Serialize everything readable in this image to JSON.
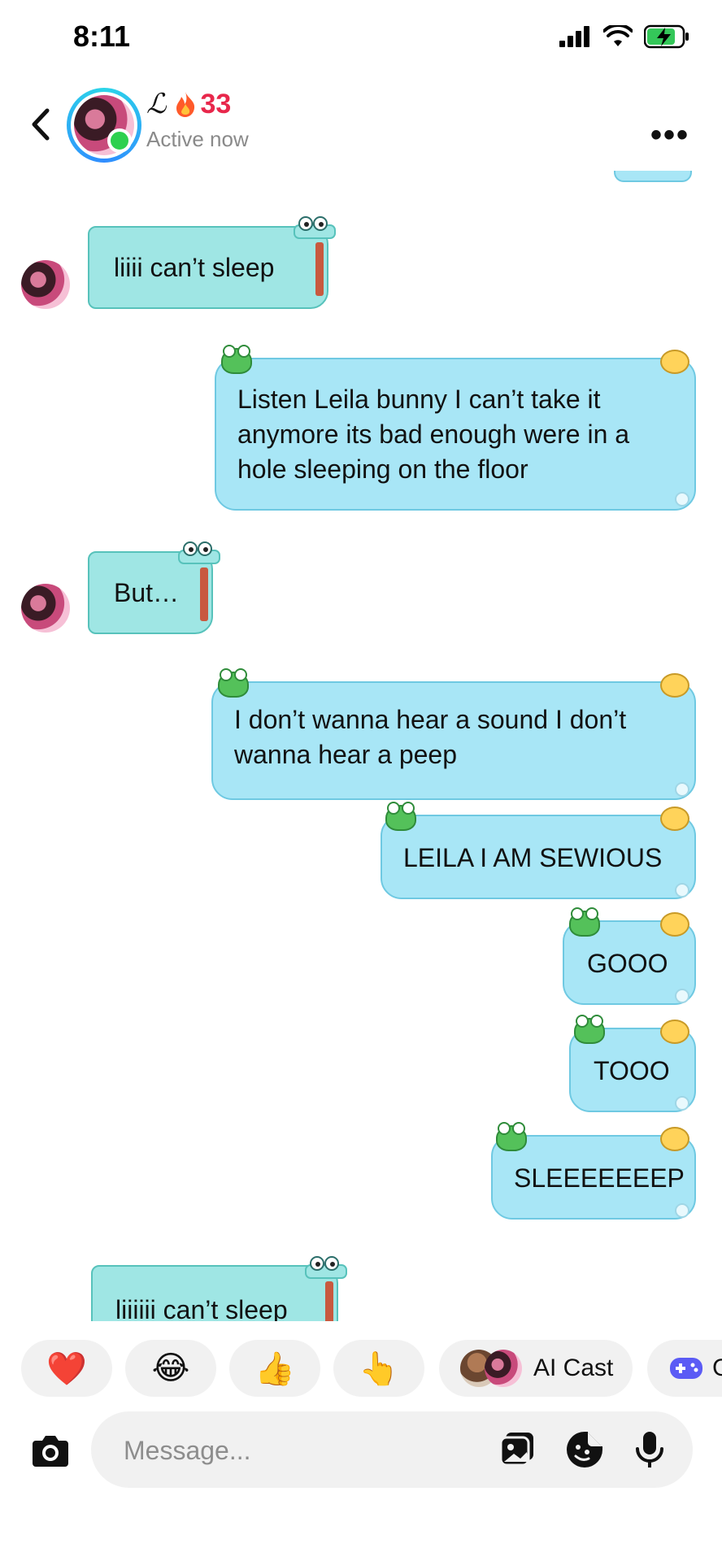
{
  "status_bar": {
    "time": "8:11"
  },
  "header": {
    "name": "ℒ",
    "streak_count": "33",
    "streak_icon": "fire-icon",
    "status": "Active now"
  },
  "messages": [
    {
      "side": "in",
      "text": "liiii can’t sleep"
    },
    {
      "side": "out",
      "lines": [
        "Listen Leila bunny I can’t take it",
        "anymore its bad enough were in a",
        "hole sleeping on the floor"
      ]
    },
    {
      "side": "in",
      "text": "But…"
    },
    {
      "side": "out",
      "lines": [
        "I don’t wanna hear a sound I don’t",
        "wanna hear a peep"
      ]
    },
    {
      "side": "out",
      "text": "LEILA I AM SEWIOUS"
    },
    {
      "side": "out",
      "text": "GOOO"
    },
    {
      "side": "out",
      "text": "TOOO"
    },
    {
      "side": "out",
      "text": "SLEEEEEEEP"
    },
    {
      "side": "in",
      "text": "liiiiii can’t sleep"
    }
  ],
  "reactions": [
    {
      "emoji": "❤️",
      "icon": "heart-icon"
    },
    {
      "emoji": "😂",
      "icon": "laughing-emoji-icon"
    },
    {
      "emoji": "👍",
      "icon": "thumbs-up-icon"
    },
    {
      "emoji": "👆",
      "icon": "pointing-up-icon"
    },
    {
      "label": "AI Cast",
      "icon": "ai-cast-icon"
    },
    {
      "label": "G",
      "icon": "game-controller-icon"
    }
  ],
  "composer": {
    "placeholder": "Message..."
  },
  "colors": {
    "incoming_bubble": "#9fe6e4",
    "outgoing_bubble": "#a8e6f6",
    "streak": "#e8274b",
    "online": "#2ed04f"
  }
}
